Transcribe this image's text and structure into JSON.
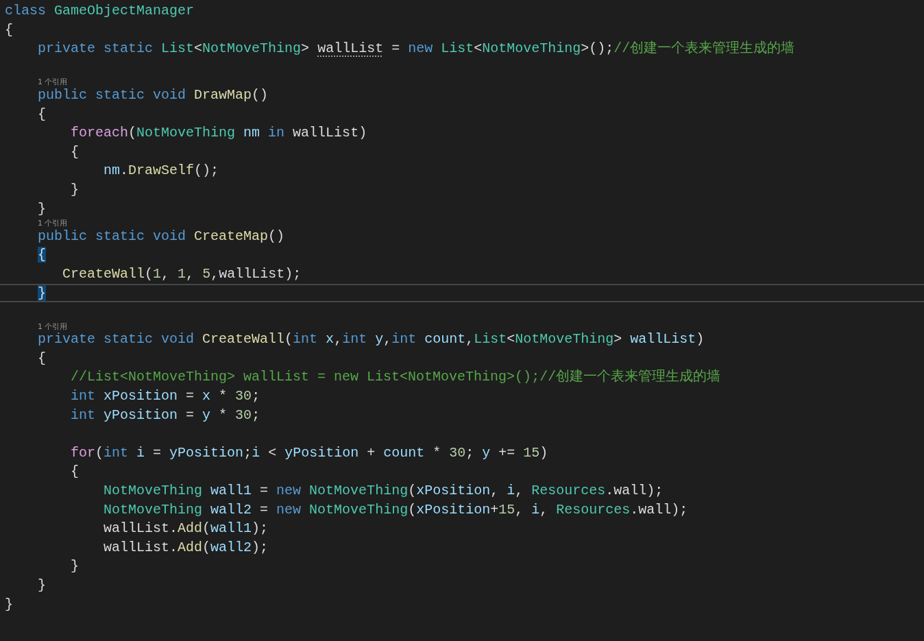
{
  "editor": {
    "lines": [
      {
        "kind": "code",
        "current": false,
        "tokens": [
          {
            "kind": "keyword",
            "text": "class "
          },
          {
            "kind": "type",
            "text": "GameObjectManager"
          }
        ]
      },
      {
        "kind": "code",
        "current": false,
        "tokens": [
          {
            "kind": "plain",
            "text": "{"
          }
        ]
      },
      {
        "kind": "code",
        "current": false,
        "tokens": [
          {
            "kind": "keyword",
            "text": "    private static "
          },
          {
            "kind": "type",
            "text": "List"
          },
          {
            "kind": "plain",
            "text": "<"
          },
          {
            "kind": "type",
            "text": "NotMoveThing"
          },
          {
            "kind": "plain",
            "text": "> "
          },
          {
            "kind": "hint",
            "text": "wallList"
          },
          {
            "kind": "plain",
            "text": " = "
          },
          {
            "kind": "keyword",
            "text": "new "
          },
          {
            "kind": "type",
            "text": "List"
          },
          {
            "kind": "plain",
            "text": "<"
          },
          {
            "kind": "type",
            "text": "NotMoveThing"
          },
          {
            "kind": "plain",
            "text": ">();"
          },
          {
            "kind": "comment",
            "text": "//创建一个表来管理生成的墙"
          }
        ]
      },
      {
        "kind": "blank",
        "current": false
      },
      {
        "kind": "lens",
        "text": "1 个引用"
      },
      {
        "kind": "code",
        "current": false,
        "tokens": [
          {
            "kind": "keyword",
            "text": "    public static void "
          },
          {
            "kind": "function",
            "text": "DrawMap"
          },
          {
            "kind": "plain",
            "text": "()"
          }
        ]
      },
      {
        "kind": "code",
        "current": false,
        "tokens": [
          {
            "kind": "plain",
            "text": "    {"
          }
        ]
      },
      {
        "kind": "code",
        "current": false,
        "tokens": [
          {
            "kind": "control",
            "text": "        foreach"
          },
          {
            "kind": "plain",
            "text": "("
          },
          {
            "kind": "type",
            "text": "NotMoveThing"
          },
          {
            "kind": "variable",
            "text": " nm "
          },
          {
            "kind": "keyword",
            "text": "in"
          },
          {
            "kind": "plain",
            "text": " wallList)"
          }
        ]
      },
      {
        "kind": "code",
        "current": false,
        "tokens": [
          {
            "kind": "plain",
            "text": "        {"
          }
        ]
      },
      {
        "kind": "code",
        "current": false,
        "tokens": [
          {
            "kind": "variable",
            "text": "            nm"
          },
          {
            "kind": "plain",
            "text": "."
          },
          {
            "kind": "function",
            "text": "DrawSelf"
          },
          {
            "kind": "plain",
            "text": "();"
          }
        ]
      },
      {
        "kind": "code",
        "current": false,
        "tokens": [
          {
            "kind": "plain",
            "text": "        }"
          }
        ]
      },
      {
        "kind": "code",
        "current": false,
        "tokens": [
          {
            "kind": "plain",
            "text": "    }"
          }
        ]
      },
      {
        "kind": "lens",
        "text": "1 个引用"
      },
      {
        "kind": "code",
        "current": false,
        "tokens": [
          {
            "kind": "keyword",
            "text": "    public static void "
          },
          {
            "kind": "function",
            "text": "CreateMap"
          },
          {
            "kind": "plain",
            "text": "()"
          }
        ]
      },
      {
        "kind": "code",
        "current": false,
        "tokens": [
          {
            "kind": "brace-match",
            "text": "    {"
          }
        ]
      },
      {
        "kind": "code",
        "current": false,
        "tokens": [
          {
            "kind": "function",
            "text": "       CreateWall"
          },
          {
            "kind": "plain",
            "text": "("
          },
          {
            "kind": "number",
            "text": "1"
          },
          {
            "kind": "plain",
            "text": ", "
          },
          {
            "kind": "number",
            "text": "1"
          },
          {
            "kind": "plain",
            "text": ", "
          },
          {
            "kind": "number",
            "text": "5"
          },
          {
            "kind": "plain",
            "text": ",wallList);"
          }
        ]
      },
      {
        "kind": "code",
        "current": true,
        "tokens": [
          {
            "kind": "brace-match",
            "text": "    }"
          }
        ]
      },
      {
        "kind": "blank",
        "current": false
      },
      {
        "kind": "lens",
        "text": "1 个引用"
      },
      {
        "kind": "code",
        "current": false,
        "tokens": [
          {
            "kind": "keyword",
            "text": "    private static void "
          },
          {
            "kind": "function",
            "text": "CreateWall"
          },
          {
            "kind": "plain",
            "text": "("
          },
          {
            "kind": "keyword",
            "text": "int "
          },
          {
            "kind": "variable",
            "text": "x"
          },
          {
            "kind": "plain",
            "text": ","
          },
          {
            "kind": "keyword",
            "text": "int "
          },
          {
            "kind": "variable",
            "text": "y"
          },
          {
            "kind": "plain",
            "text": ","
          },
          {
            "kind": "keyword",
            "text": "int "
          },
          {
            "kind": "variable",
            "text": "count"
          },
          {
            "kind": "plain",
            "text": ","
          },
          {
            "kind": "type",
            "text": "List"
          },
          {
            "kind": "plain",
            "text": "<"
          },
          {
            "kind": "type",
            "text": "NotMoveThing"
          },
          {
            "kind": "plain",
            "text": "> "
          },
          {
            "kind": "variable",
            "text": "wallList"
          },
          {
            "kind": "plain",
            "text": ")"
          }
        ]
      },
      {
        "kind": "code",
        "current": false,
        "tokens": [
          {
            "kind": "plain",
            "text": "    {"
          }
        ]
      },
      {
        "kind": "code",
        "current": false,
        "tokens": [
          {
            "kind": "comment",
            "text": "        //List<NotMoveThing> wallList = new List<NotMoveThing>();//创建一个表来管理生成的墙"
          }
        ]
      },
      {
        "kind": "code",
        "current": false,
        "tokens": [
          {
            "kind": "keyword",
            "text": "        int "
          },
          {
            "kind": "variable",
            "text": "xPosition"
          },
          {
            "kind": "plain",
            "text": " = "
          },
          {
            "kind": "variable",
            "text": "x"
          },
          {
            "kind": "plain",
            "text": " * "
          },
          {
            "kind": "number",
            "text": "30"
          },
          {
            "kind": "plain",
            "text": ";"
          }
        ]
      },
      {
        "kind": "code",
        "current": false,
        "tokens": [
          {
            "kind": "keyword",
            "text": "        int "
          },
          {
            "kind": "variable",
            "text": "yPosition"
          },
          {
            "kind": "plain",
            "text": " = "
          },
          {
            "kind": "variable",
            "text": "y"
          },
          {
            "kind": "plain",
            "text": " * "
          },
          {
            "kind": "number",
            "text": "30"
          },
          {
            "kind": "plain",
            "text": ";"
          }
        ]
      },
      {
        "kind": "blank",
        "current": false
      },
      {
        "kind": "code",
        "current": false,
        "tokens": [
          {
            "kind": "control",
            "text": "        for"
          },
          {
            "kind": "plain",
            "text": "("
          },
          {
            "kind": "keyword",
            "text": "int "
          },
          {
            "kind": "variable",
            "text": "i"
          },
          {
            "kind": "plain",
            "text": " = "
          },
          {
            "kind": "variable",
            "text": "yPosition"
          },
          {
            "kind": "plain",
            "text": ";"
          },
          {
            "kind": "variable",
            "text": "i"
          },
          {
            "kind": "plain",
            "text": " < "
          },
          {
            "kind": "variable",
            "text": "yPosition"
          },
          {
            "kind": "plain",
            "text": " + "
          },
          {
            "kind": "variable",
            "text": "count"
          },
          {
            "kind": "plain",
            "text": " * "
          },
          {
            "kind": "number",
            "text": "30"
          },
          {
            "kind": "plain",
            "text": "; "
          },
          {
            "kind": "variable",
            "text": "y"
          },
          {
            "kind": "plain",
            "text": " += "
          },
          {
            "kind": "number",
            "text": "15"
          },
          {
            "kind": "plain",
            "text": ")"
          }
        ]
      },
      {
        "kind": "code",
        "current": false,
        "tokens": [
          {
            "kind": "plain",
            "text": "        {"
          }
        ]
      },
      {
        "kind": "code",
        "current": false,
        "tokens": [
          {
            "kind": "type",
            "text": "            NotMoveThing "
          },
          {
            "kind": "variable",
            "text": "wall1"
          },
          {
            "kind": "plain",
            "text": " = "
          },
          {
            "kind": "keyword",
            "text": "new "
          },
          {
            "kind": "type",
            "text": "NotMoveThing"
          },
          {
            "kind": "plain",
            "text": "("
          },
          {
            "kind": "variable",
            "text": "xPosition"
          },
          {
            "kind": "plain",
            "text": ", "
          },
          {
            "kind": "variable",
            "text": "i"
          },
          {
            "kind": "plain",
            "text": ", "
          },
          {
            "kind": "type",
            "text": "Resources"
          },
          {
            "kind": "plain",
            "text": ".wall);"
          }
        ]
      },
      {
        "kind": "code",
        "current": false,
        "tokens": [
          {
            "kind": "type",
            "text": "            NotMoveThing "
          },
          {
            "kind": "variable",
            "text": "wall2"
          },
          {
            "kind": "plain",
            "text": " = "
          },
          {
            "kind": "keyword",
            "text": "new "
          },
          {
            "kind": "type",
            "text": "NotMoveThing"
          },
          {
            "kind": "plain",
            "text": "("
          },
          {
            "kind": "variable",
            "text": "xPosition"
          },
          {
            "kind": "plain",
            "text": "+"
          },
          {
            "kind": "number",
            "text": "15"
          },
          {
            "kind": "plain",
            "text": ", "
          },
          {
            "kind": "variable",
            "text": "i"
          },
          {
            "kind": "plain",
            "text": ", "
          },
          {
            "kind": "type",
            "text": "Resources"
          },
          {
            "kind": "plain",
            "text": ".wall);"
          }
        ]
      },
      {
        "kind": "code",
        "current": false,
        "tokens": [
          {
            "kind": "plain",
            "text": "            wallList."
          },
          {
            "kind": "function",
            "text": "Add"
          },
          {
            "kind": "plain",
            "text": "("
          },
          {
            "kind": "variable",
            "text": "wall1"
          },
          {
            "kind": "plain",
            "text": ");"
          }
        ]
      },
      {
        "kind": "code",
        "current": false,
        "tokens": [
          {
            "kind": "plain",
            "text": "            wallList."
          },
          {
            "kind": "function",
            "text": "Add"
          },
          {
            "kind": "plain",
            "text": "("
          },
          {
            "kind": "variable",
            "text": "wall2"
          },
          {
            "kind": "plain",
            "text": ");"
          }
        ]
      },
      {
        "kind": "code",
        "current": false,
        "tokens": [
          {
            "kind": "plain",
            "text": "        }"
          }
        ]
      },
      {
        "kind": "code",
        "current": false,
        "tokens": [
          {
            "kind": "plain",
            "text": "    }"
          }
        ]
      },
      {
        "kind": "code",
        "current": false,
        "tokens": [
          {
            "kind": "plain",
            "text": "}"
          }
        ]
      }
    ]
  }
}
